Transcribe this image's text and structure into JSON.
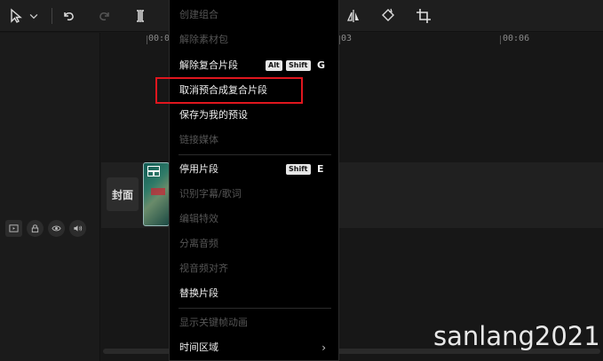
{
  "toolbar": {
    "icons": [
      "pointer-icon",
      "chevron-down-icon",
      "undo-icon",
      "redo-icon",
      "split-icon",
      "mirror-icon",
      "rotate-icon",
      "crop-icon"
    ]
  },
  "ruler": {
    "ticks": [
      "00:0",
      "03",
      "00:06"
    ]
  },
  "track": {
    "cover_label": "封面"
  },
  "menu": {
    "items": [
      {
        "label": "创建组合",
        "enabled": false
      },
      {
        "label": "解除素材包",
        "enabled": false
      },
      {
        "label": "解除复合片段",
        "enabled": true,
        "keys": [
          "Alt",
          "Shift"
        ],
        "key_letter": "G"
      },
      {
        "label": "取消预合成复合片段",
        "enabled": true,
        "highlighted": true
      },
      {
        "label": "保存为我的预设",
        "enabled": true
      },
      {
        "label": "链接媒体",
        "enabled": false
      },
      {
        "label": "停用片段",
        "enabled": true,
        "keys": [
          "Shift"
        ],
        "key_letter": "E"
      },
      {
        "label": "识别字幕/歌词",
        "enabled": false
      },
      {
        "label": "编辑特效",
        "enabled": false
      },
      {
        "label": "分离音频",
        "enabled": false
      },
      {
        "label": "视音频对齐",
        "enabled": false
      },
      {
        "label": "替换片段",
        "enabled": true
      },
      {
        "label": "显示关键帧动画",
        "enabled": false
      },
      {
        "label": "时间区域",
        "enabled": true,
        "submenu": true
      }
    ]
  },
  "colors": {
    "highlight_border": "#e0161e",
    "menu_bg": "#000000",
    "enabled_text": "#f0f0f0",
    "disabled_text": "#555555"
  },
  "watermark": "sanlang2021"
}
